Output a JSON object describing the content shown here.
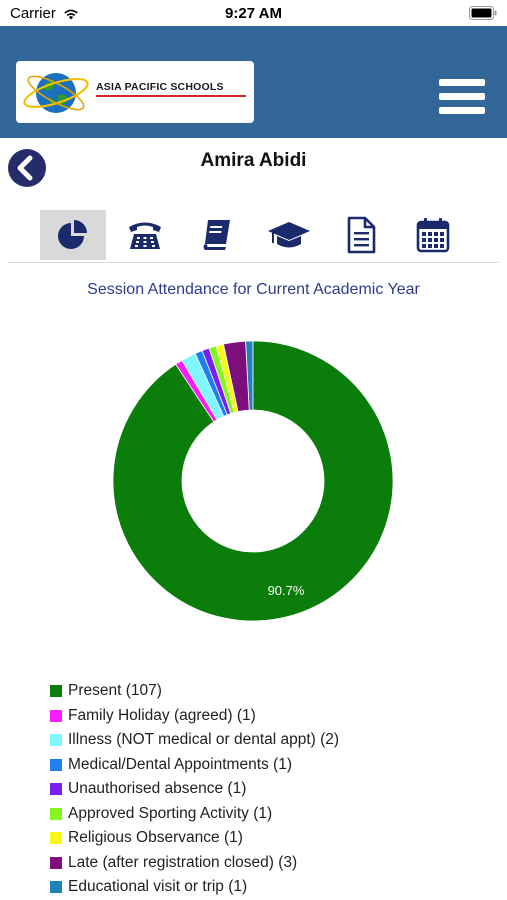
{
  "status_bar": {
    "carrier": "Carrier",
    "time": "9:27 AM"
  },
  "header": {
    "logo_text": "ASIA PACIFIC SCHOOLS"
  },
  "page": {
    "title": "Amira Abidi"
  },
  "tabs": [
    {
      "name": "attendance",
      "icon": "pie-chart-icon",
      "active": true
    },
    {
      "name": "contact",
      "icon": "phone-icon",
      "active": false
    },
    {
      "name": "books",
      "icon": "book-icon",
      "active": false
    },
    {
      "name": "academic",
      "icon": "graduation-cap-icon",
      "active": false
    },
    {
      "name": "reports",
      "icon": "document-icon",
      "active": false
    },
    {
      "name": "calendar",
      "icon": "calendar-icon",
      "active": false
    }
  ],
  "chart_data": {
    "type": "pie",
    "title": "Session Attendance for Current Academic Year",
    "donut": true,
    "data_label": "90.7%",
    "series": [
      {
        "name": "Present",
        "value": 107,
        "color": "#0a7d0a"
      },
      {
        "name": "Family Holiday (agreed)",
        "value": 1,
        "color": "#ff1aff"
      },
      {
        "name": "Illness (NOT medical or dental appt)",
        "value": 2,
        "color": "#7ff7ff"
      },
      {
        "name": "Medical/Dental Appointments",
        "value": 1,
        "color": "#1f7ff0"
      },
      {
        "name": "Unauthorised absence",
        "value": 1,
        "color": "#7a1ff0"
      },
      {
        "name": "Approved Sporting Activity",
        "value": 1,
        "color": "#84f51e"
      },
      {
        "name": "Religious Observance",
        "value": 1,
        "color": "#f7f71a"
      },
      {
        "name": "Late (after registration closed)",
        "value": 3,
        "color": "#7d0f7d"
      },
      {
        "name": "Educational visit or trip",
        "value": 1,
        "color": "#1f82b8"
      }
    ]
  },
  "legend": [
    "Present (107)",
    "Family Holiday (agreed) (1)",
    "Illness (NOT medical or dental appt) (2)",
    "Medical/Dental Appointments (1)",
    "Unauthorised absence (1)",
    "Approved Sporting Activity (1)",
    "Religious Observance (1)",
    "Late (after registration closed) (3)",
    "Educational visit or trip (1)"
  ]
}
